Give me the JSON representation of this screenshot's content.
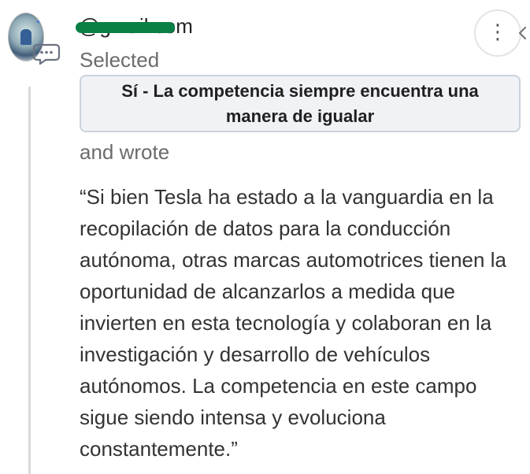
{
  "header": {
    "email": "@gmail.com"
  },
  "selected": {
    "label": "Selected",
    "choice": "Sí - La competencia siempre encuentra una manera de igualar"
  },
  "response": {
    "intro": "and wrote",
    "text": "“Si bien Tesla ha estado a la vanguardia en la recopilación de datos para la conducción autónoma, otras marcas automotrices tienen la oportunidad de alcanzarlos a medida que invierten en esta tecnología y colaboran en la investigación y desarrollo de vehículos autónomos. La competencia en este campo sigue siendo intensa y evoluciona constantemente.”"
  },
  "icons": {
    "comment": "comment-icon",
    "menu": "more-vertical-icon",
    "chevron": "chevron-left-icon"
  },
  "colors": {
    "accent_border": "#cbd3dc",
    "choice_bg": "#f0f2f6",
    "redaction": "#0a7f45"
  }
}
